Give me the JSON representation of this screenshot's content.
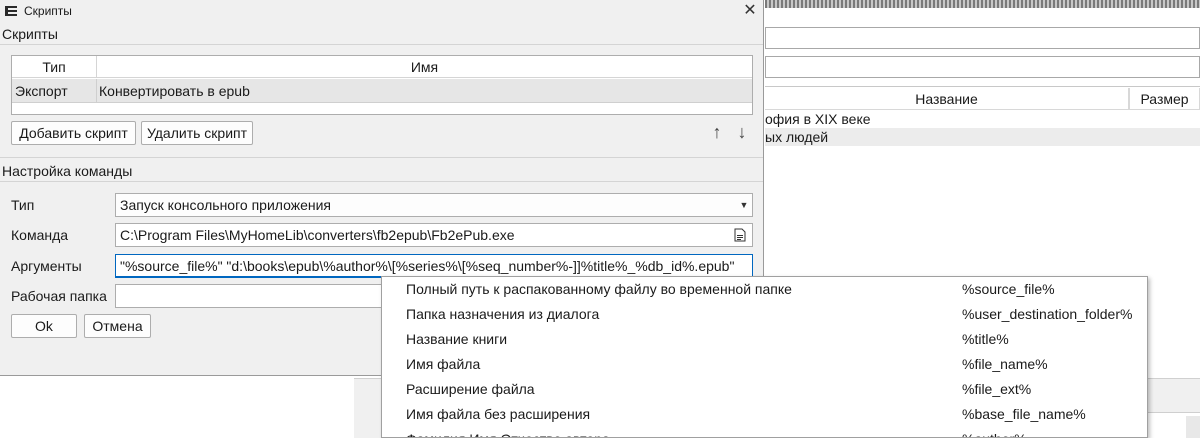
{
  "dialog": {
    "title": "Скрипты",
    "close_glyph": "✕",
    "scripts_section_title": "Скрипты",
    "table": {
      "headers": [
        "Тип",
        "Имя"
      ],
      "rows": [
        {
          "type": "Экспорт",
          "name": "Конвертировать в epub"
        }
      ]
    },
    "add_button": "Добавить скрипт",
    "delete_button": "Удалить скрипт",
    "move_up_glyph": "↑",
    "move_down_glyph": "↓",
    "command_section_title": "Настройка команды",
    "type_label": "Тип",
    "type_value": "Запуск консольного приложения",
    "command_label": "Команда",
    "command_value": "C:\\Program Files\\MyHomeLib\\converters\\fb2epub\\Fb2ePub.exe",
    "arguments_label": "Аргументы",
    "arguments_value": "\"%source_file%\" \"d:\\books\\epub\\%author%\\[%series%\\[%seq_number%-]]%title%_%db_id%.epub\"",
    "workdir_label": "Рабочая папка",
    "workdir_value": "",
    "ok_button": "Ok",
    "cancel_button": "Отмена"
  },
  "macro_popup": {
    "items": [
      {
        "desc": "Полный путь к распакованному файлу во временной папке",
        "macro": "%source_file%"
      },
      {
        "desc": "Папка назначения из диалога",
        "macro": "%user_destination_folder%"
      },
      {
        "desc": "Название книги",
        "macro": "%title%"
      },
      {
        "desc": "Имя файла",
        "macro": "%file_name%"
      },
      {
        "desc": "Расширение файла",
        "macro": "%file_ext%"
      },
      {
        "desc": "Имя файла без расширения",
        "macro": "%base_file_name%"
      },
      {
        "desc": "Фамилия Имя Отчество автора",
        "macro": "%author%"
      }
    ]
  },
  "background_app": {
    "columns": [
      "Название",
      "Размер"
    ],
    "rows": [
      "офия в XIX веке",
      "ых людей"
    ]
  },
  "colors": {
    "accent": "#0067c0",
    "selection_row": "#e6e6e6"
  }
}
